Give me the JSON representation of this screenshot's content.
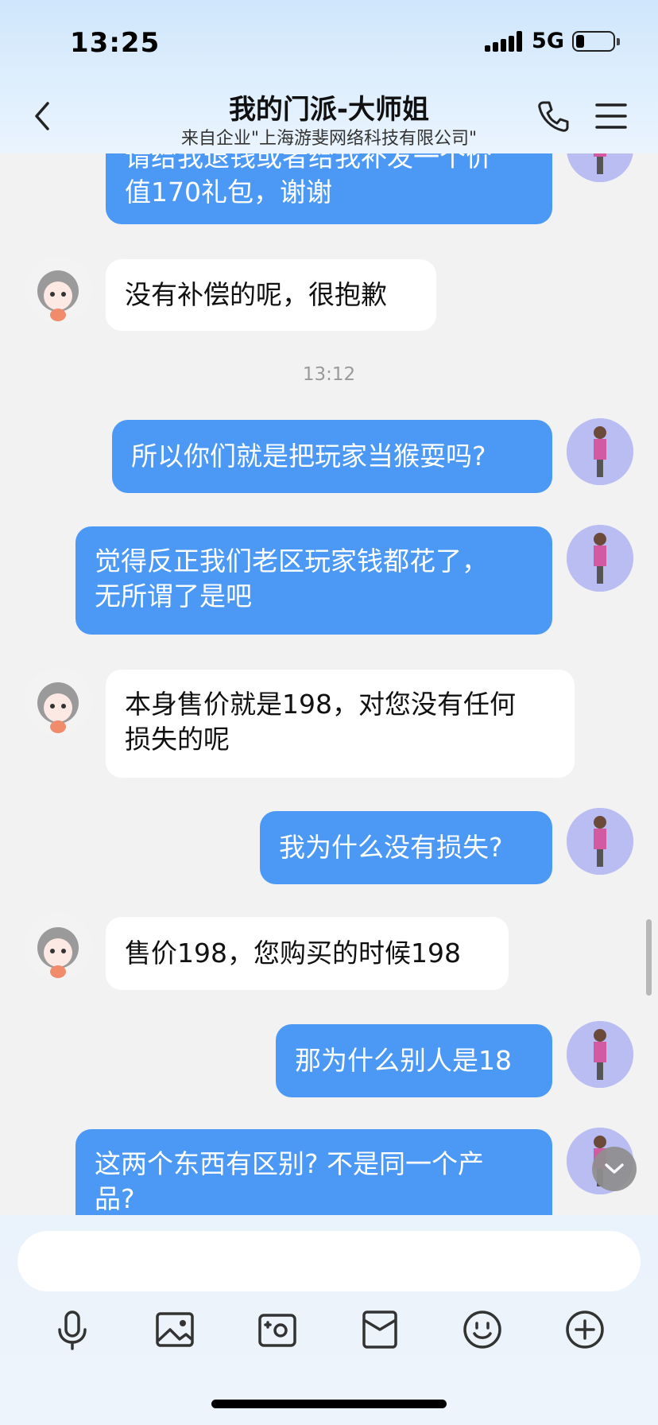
{
  "status_bar": {
    "time": "13:25",
    "network": "5G"
  },
  "header": {
    "title": "我的门派-大师姐",
    "subtitle": "来自企业\"上海游斐网络科技有限公司\""
  },
  "messages": {
    "m0": {
      "line1": "请给我退钱或者给我补发一个价",
      "line2": "值170礼包，谢谢"
    },
    "m1": {
      "text": "没有补偿的呢，很抱歉"
    },
    "ts1": {
      "text": "13:12"
    },
    "m2": {
      "text": "所以你们就是把玩家当猴耍吗?"
    },
    "m3": {
      "line1": "觉得反正我们老区玩家钱都花了，",
      "line2": "无所谓了是吧"
    },
    "m4": {
      "line1": "本身售价就是198，对您没有任何",
      "line2": "损失的呢"
    },
    "m5": {
      "text": "我为什么没有损失?"
    },
    "m6": {
      "text": "售价198，您购买的时候198"
    },
    "m7": {
      "text": "那为什么别人是18"
    },
    "m8": {
      "line1": "这两个东西有区别? 不是同一个产",
      "line2": "品?"
    }
  },
  "input": {
    "value": ""
  },
  "icons": {
    "back": "chevron-left-icon",
    "phone": "phone-icon",
    "menu": "menu-icon",
    "toolbar": [
      "microphone-icon",
      "image-icon",
      "camera-icon",
      "red-packet-icon",
      "emoji-icon",
      "plus-icon"
    ]
  },
  "colors": {
    "outgoing_bubble": "#4b98f5",
    "incoming_bubble": "#ffffff",
    "background": "#f2f2f2"
  }
}
